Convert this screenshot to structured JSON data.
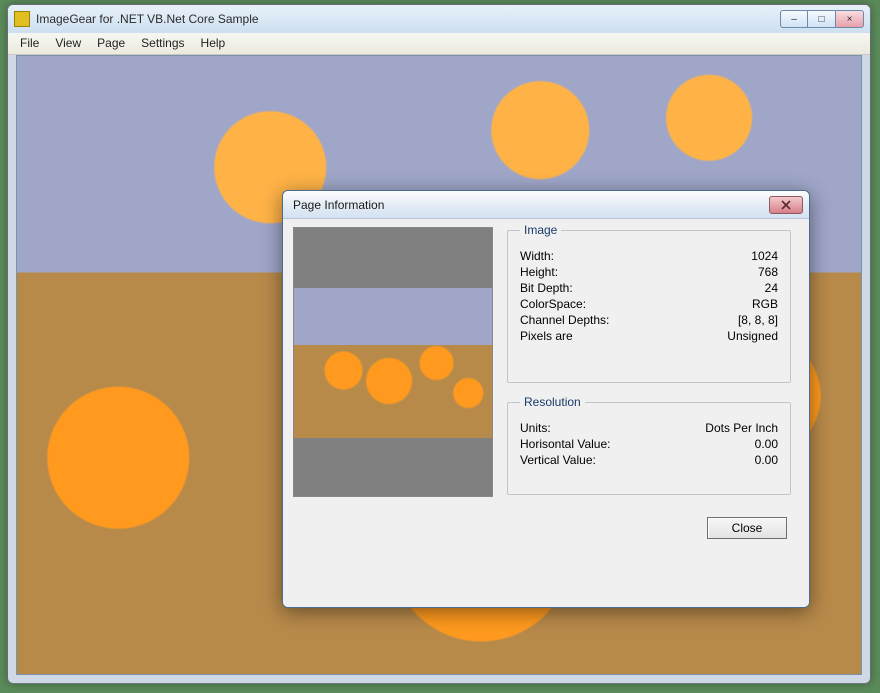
{
  "window": {
    "title": "ImageGear for .NET VB.Net Core Sample",
    "controls": {
      "minimize": "–",
      "maximize": "□",
      "close": "×"
    }
  },
  "menu": {
    "items": [
      "File",
      "View",
      "Page",
      "Settings",
      "Help"
    ]
  },
  "dialog": {
    "title": "Page Information",
    "image_group": {
      "legend": "Image",
      "rows": {
        "width": {
          "label": "Width:",
          "value": "1024"
        },
        "height": {
          "label": "Height:",
          "value": "768"
        },
        "bit_depth": {
          "label": "Bit Depth:",
          "value": "24"
        },
        "colorspace": {
          "label": "ColorSpace:",
          "value": "RGB"
        },
        "channel_depths": {
          "label": "Channel Depths:",
          "value": "[8, 8, 8]"
        },
        "pixels_are": {
          "label": "Pixels are",
          "value": "Unsigned"
        }
      }
    },
    "resolution_group": {
      "legend": "Resolution",
      "rows": {
        "units": {
          "label": "Units:",
          "value": "Dots Per Inch"
        },
        "horizontal": {
          "label": "Horisontal Value:",
          "value": "0.00"
        },
        "vertical": {
          "label": "Vertical Value:",
          "value": "0.00"
        }
      }
    },
    "close_button": "Close"
  }
}
